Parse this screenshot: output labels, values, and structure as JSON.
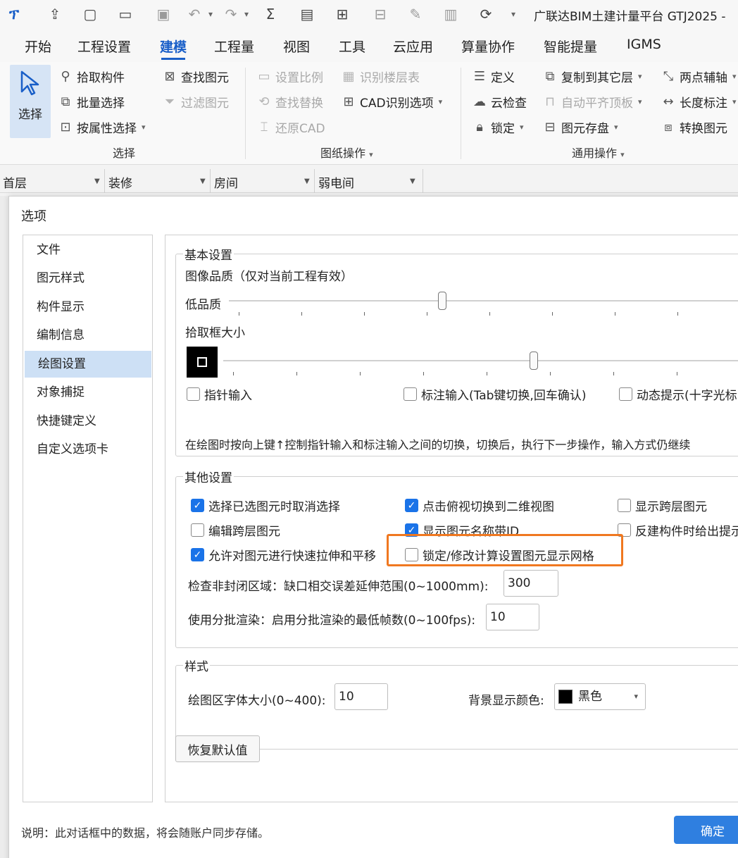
{
  "title_bar": {
    "app_title": "广联达BIM土建计量平台 GTJ2025 -"
  },
  "menu_tabs": [
    "开始",
    "工程设置",
    "建模",
    "工程量",
    "视图",
    "工具",
    "云应用",
    "算量协作",
    "智能提量",
    "IGMS"
  ],
  "active_tab": "建模",
  "ribbon": {
    "select_group": {
      "big_button": "选择",
      "items": [
        "拾取构件",
        "批量选择",
        "按属性选择"
      ],
      "find": "查找图元",
      "filter": "过滤图元",
      "label": "选择"
    },
    "drawing_group": {
      "set_scale": "设置比例",
      "identify_floor_table": "识别楼层表",
      "find_replace": "查找替换",
      "cad_options": "CAD识别选项",
      "restore_cad": "还原CAD",
      "label": "图纸操作"
    },
    "general_group": {
      "define": "定义",
      "copy_to_other_floor": "复制到其它层",
      "two_point_axis": "两点辅轴",
      "cloud_check": "云检查",
      "auto_flat_top": "自动平齐顶板",
      "length_dim": "长度标注",
      "lock": "锁定",
      "element_storage": "图元存盘",
      "convert_element": "转换图元",
      "label": "通用操作"
    }
  },
  "floor_bar": [
    "首层",
    "装修",
    "房间",
    "弱电间"
  ],
  "dialog": {
    "title": "选项",
    "nav": [
      "文件",
      "图元样式",
      "构件显示",
      "编制信息",
      "绘图设置",
      "对象捕捉",
      "快捷键定义",
      "自定义选项卡"
    ],
    "nav_selected_index": 4,
    "basic": {
      "legend": "基本设置",
      "image_quality_label": "图像品质（仅对当前工程有效）",
      "low_quality": "低品质",
      "image_quality_slider_fraction": 0.41,
      "pick_box_label": "拾取框大小",
      "pick_box_slider_fraction": 0.59,
      "pointer_input": {
        "label": "指针输入",
        "checked": false
      },
      "dim_input": {
        "label": "标注输入(Tab键切换,回车确认)",
        "checked": false
      },
      "dynamic_hint": {
        "label": "动态提示(十字光标",
        "checked": false
      },
      "hint_text": "在绘图时按向上键↑控制指针输入和标注输入之间的切换，切换后，执行下一步操作，输入方式仍继续"
    },
    "other": {
      "legend": "其他设置",
      "cb_deselect": {
        "label": "选择已选图元时取消选择",
        "checked": true
      },
      "cb_topview_2d": {
        "label": "点击俯视切换到二维视图",
        "checked": true
      },
      "cb_show_cross_floor": {
        "label": "显示跨层图元",
        "checked": false
      },
      "cb_edit_cross_floor": {
        "label": "编辑跨层图元",
        "checked": false
      },
      "cb_show_name_id": {
        "label": "显示图元名称带ID",
        "checked": true
      },
      "cb_reverse_build": {
        "label": "反建构件时给出提示",
        "checked": false
      },
      "cb_quick_stretch": {
        "label": "允许对图元进行快速拉伸和平移",
        "checked": true
      },
      "cb_lock_grid": {
        "label": "锁定/修改计算设置图元显示网格",
        "checked": false
      },
      "gap_label": "检查非封闭区域：缺口相交误差延伸范围(0~1000mm):",
      "gap_value": "300",
      "batch_label": "使用分批渲染：启用分批渲染的最低帧数(0~100fps):",
      "batch_value": "10"
    },
    "style": {
      "legend": "样式",
      "font_size_label": "绘图区字体大小(0~400):",
      "font_size_value": "10",
      "bg_color_label": "背景显示颜色:",
      "bg_color_value": "黑色",
      "bg_color_swatch": "#000000"
    },
    "restore_default": "恢复默认值",
    "note": "说明：此对话框中的数据，将会随账户同步存储。",
    "ok": "确定"
  },
  "colors": {
    "accent": "#1a5fc8",
    "highlight_box": "#f07820",
    "checkbox_on": "#1a73e8",
    "ok_button": "#2f7fe0"
  }
}
